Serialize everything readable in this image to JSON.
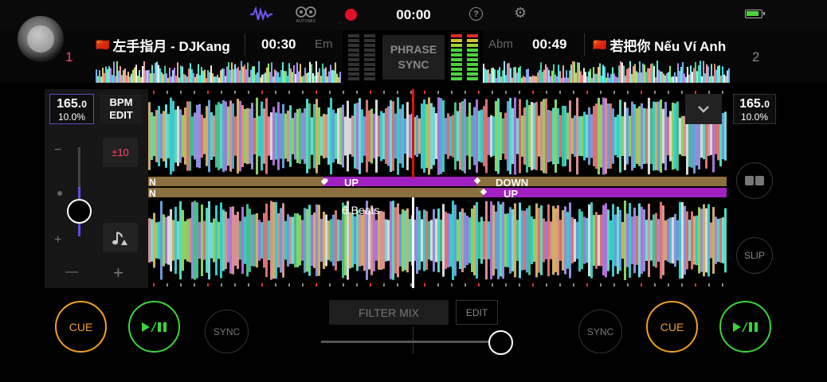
{
  "topbar": {
    "time": "00:00",
    "automix_label": "AUTOMIX",
    "help_symbol": "?",
    "gear_symbol": "⚙"
  },
  "deck1": {
    "number": "1",
    "flag": "🇨🇳",
    "title": "左手指月 - DJKang",
    "time": "00:30",
    "key": "Em",
    "bpm_int": "165.",
    "bpm_dec": "0",
    "pitch": "10.0%",
    "bpm_edit_line1": "BPM",
    "bpm_edit_line2": "EDIT",
    "range": "±10",
    "tempo_minus": "−",
    "tempo_plus": "+",
    "nudge_minus": "—",
    "nudge_plus": "+",
    "cue": "CUE",
    "sync": "SYNC",
    "tempo_level": 0.55
  },
  "deck2": {
    "number": "2",
    "flag": "🇨🇳",
    "title": "若把你 Nếu Ví Anh",
    "time": "00:49",
    "key": "Abm",
    "bpm_int": "165.",
    "bpm_dec": "0",
    "pitch": "10.0%",
    "slip": "SLIP",
    "cue": "CUE",
    "sync": "SYNC"
  },
  "center": {
    "phrase_sync_line1": "PHRASE",
    "phrase_sync_line2": "SYNC",
    "beats_label": "6 Beats",
    "phrase_labels_top": [
      "N",
      "UP",
      "DOWN"
    ],
    "phrase_labels_bottom": [
      "N",
      "UP"
    ],
    "filter_mix": "FILTER MIX",
    "edit": "EDIT",
    "crossfader_position": 0.9
  },
  "colors": {
    "accent_pink": "#e8265c",
    "cue_orange": "#f0a020",
    "play_green": "#3cd43c",
    "phrase_gold": "#8b6f3e",
    "phrase_purple": "#a020c0",
    "playhead_red": "#e01010",
    "battery": "#4cd43c"
  }
}
